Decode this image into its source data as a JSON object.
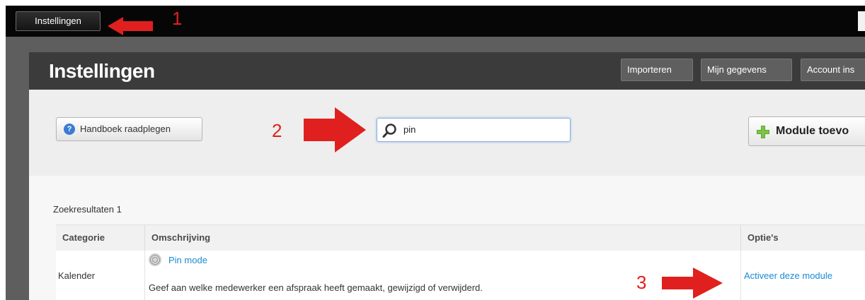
{
  "topbar": {
    "settings_button": "Instellingen"
  },
  "panel": {
    "title": "Instellingen",
    "header_buttons": [
      "Importeren",
      "Mijn gegevens",
      "Account ins"
    ]
  },
  "toolbar": {
    "help_button": "Handboek raadplegen",
    "search_value": "pin",
    "add_module_button": "Module toevo"
  },
  "results": {
    "count_label": "Zoekresultaten 1",
    "columns": [
      "Categorie",
      "Omschrijving",
      "Optie's"
    ],
    "rows": [
      {
        "category": "Kalender",
        "module_name": "Pin mode",
        "description": "Geef aan welke medewerker een afspraak heeft gemaakt, gewijzigd of verwijderd.",
        "action": "Activeer deze module"
      }
    ]
  },
  "annotations": {
    "markers": [
      "1",
      "2",
      "3"
    ],
    "color": "#e0201e"
  },
  "colors": {
    "header_bg": "#3b3b3b",
    "link": "#1a8bd1",
    "plus_icon": "#5ba82b"
  }
}
